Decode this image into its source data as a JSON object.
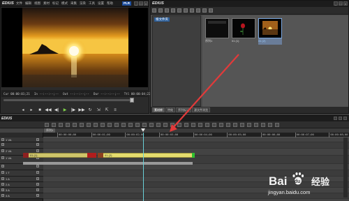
{
  "player": {
    "app_name": "EDIUS",
    "menu": [
      "文件",
      "编辑",
      "视图",
      "素材",
      "标记",
      "模式",
      "采集",
      "渲染",
      "工具",
      "设置",
      "帮助"
    ],
    "mode": "PLR",
    "timecode": {
      "cur": "Cur 00:00:01;21",
      "in": "In --:--:--;--",
      "out": "Out --:--:--;--",
      "dur": "Dur --:--:--;--",
      "ttl": "Ttl 00:00:04;22"
    }
  },
  "bin": {
    "app_name": "EDIUS",
    "tree_label": "根文件夹",
    "clips": [
      {
        "caption": "序列1",
        "kind": "sequence"
      },
      {
        "caption": "01 (1)",
        "kind": "rose"
      },
      {
        "caption": "01 (2)",
        "kind": "sunset",
        "selected": true
      }
    ],
    "tabs": [
      "素材库",
      "特效",
      "序列标记",
      "源文件浏览"
    ]
  },
  "timeline": {
    "title": "EDIUS",
    "sequence_tab": "序列1",
    "ruler_labels": [
      "00:00:00;00",
      "00:00:01;00",
      "00:00:02;00",
      "00:00:03;00",
      "00:00:04;00",
      "00:00:05;00",
      "00:00:06;00",
      "00:00:07;00",
      "00:00:08;00"
    ],
    "tracks": [
      {
        "name": "1 VA"
      },
      {
        "name": ""
      },
      {
        "name": "2 VA"
      },
      {
        "name": "1 VA"
      },
      {
        "name": ""
      },
      {
        "name": "1 T"
      },
      {
        "name": "1 A"
      },
      {
        "name": "2 A"
      },
      {
        "name": "3 A"
      },
      {
        "name": "4 A"
      }
    ],
    "clips": [
      {
        "label": "01 (1)"
      },
      {
        "label": "01 (2)"
      }
    ]
  },
  "colors": {
    "accent": "#1e4fa0",
    "clip_video": "#e4dc6e",
    "playhead": "#69d0d8",
    "annotation_arrow": "#e23a3a"
  },
  "watermark": {
    "brand": "Bai",
    "brand_cn": "经验",
    "url": "jingyan.baidu.com"
  }
}
